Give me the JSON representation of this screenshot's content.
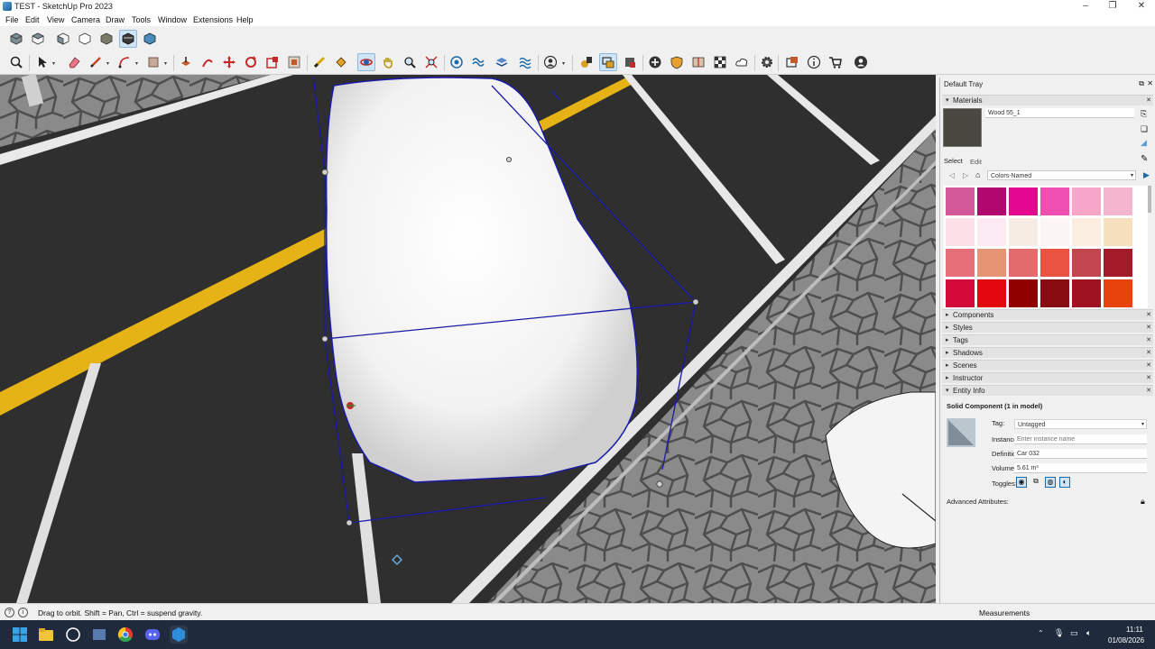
{
  "window": {
    "title": "TEST - SketchUp Pro 2023"
  },
  "menu": [
    "File",
    "Edit",
    "View",
    "Camera",
    "Draw",
    "Tools",
    "Window",
    "Extensions",
    "Help"
  ],
  "tray": {
    "title": "Default Tray",
    "materials": {
      "header": "Materials",
      "current_material": "Wood 55_1",
      "tabs": {
        "select": "Select",
        "edit": "Edit"
      },
      "library": "Colors-Named",
      "swatch_colors": [
        "#d3589a",
        "#b0086e",
        "#e3088f",
        "#ef4fb0",
        "#f6a7c9",
        "#f5b6cd",
        "#fbe1e6",
        "#fbeaf2",
        "#f7ece4",
        "#fbf6f4",
        "#fbeee0",
        "#f6dfbd",
        "#e46f79",
        "#e59474",
        "#e46b6b",
        "#e8543f",
        "#c24650",
        "#a31b28",
        "#d3093a",
        "#e30710",
        "#900000",
        "#880d13",
        "#9f1220",
        "#e8430a"
      ]
    },
    "collapsed_panels": [
      "Components",
      "Styles",
      "Tags",
      "Shadows",
      "Scenes",
      "Instructor"
    ],
    "entity_info": {
      "header": "Entity Info",
      "heading": "Solid Component (1 in model)",
      "tag_label": "Tag:",
      "tag_value": "Untagged",
      "instance_label": "Instance:",
      "instance_placeholder": "Enter instance name",
      "definition_label": "Definition:",
      "definition_value": "Car 032",
      "volume_label": "Volume:",
      "volume_value": "5.61 m³",
      "toggles_label": "Toggles:",
      "advanced_label": "Advanced Attributes:"
    }
  },
  "status": {
    "hint": "Drag to orbit. Shift = Pan, Ctrl = suspend gravity.",
    "measurements_label": "Measurements"
  },
  "taskbar": {
    "time": "11:11",
    "date": "01/08/2026"
  },
  "colors": {
    "asphalt": "#2f2f2f",
    "road_line": "#e5b315",
    "selection": "#1a1aa8",
    "tray_bg": "#f0f0f0"
  }
}
